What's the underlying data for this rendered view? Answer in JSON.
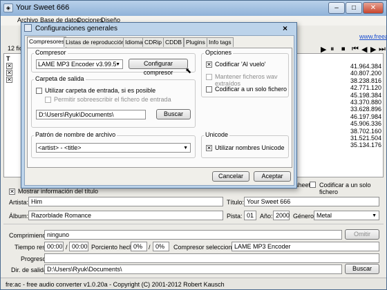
{
  "app": {
    "title": "Your Sweet 666",
    "icon_glyph": "◈",
    "menu": [
      "Archivo",
      "Base de datos",
      "Opciones",
      "Diseño"
    ],
    "link": "www.freeac.org",
    "filecount_prefix": "12 fic",
    "col_letter": "T",
    "sizes": [
      "41.964.384",
      "40.807.200",
      "38.238.816",
      "42.771.120",
      "45.198.384",
      "43.370.880",
      "33.628.896",
      "46.197.984",
      "45.906.336",
      "38.702.160",
      "31.521.504",
      "35.134.176"
    ],
    "player_controls": [
      "▶",
      "⏸",
      "⏹",
      "⏮",
      "◀",
      "▶",
      "⏭"
    ],
    "behind_options": {
      "sheet": "sheet",
      "single_file": "Codificar a un solo fichero"
    },
    "show_title_info": "Mostrar información del título",
    "artist_label": "Artista:",
    "artist": "Him",
    "title_label": "Título:",
    "album_label": "Álbum:",
    "album": "Razorblade Romance",
    "track_label": "Pista:",
    "track": "01",
    "year_label": "Año:",
    "year": "2000",
    "genre_label": "Género:",
    "genre": "Metal",
    "compressing_label": "Comprimiendo:",
    "compressing": "ninguno",
    "skip_button": "Omitir",
    "time_label": "Tiempo res.:",
    "time1": "00:00",
    "time_sep": "/",
    "time2": "00:00",
    "percent_label": "Porciento hecho:",
    "pct1": "0%",
    "pct2": "0%",
    "encoder_label": "Compresor seleccionado:",
    "encoder": "LAME MP3 Encoder",
    "progress_label": "Progreso:",
    "outdir_label": "Dir. de salida:",
    "outdir": "D:\\Users\\Ryuk\\Documents\\",
    "browse_button": "Buscar",
    "status": "fre:ac - free audio converter v1.0.20a - Copyright (C) 2001-2012 Robert Kausch"
  },
  "dialog": {
    "title": "Configuraciones generales",
    "close": "×",
    "tabs": [
      "Compresores",
      "Listas de reproducción",
      "Idioma",
      "CDRip",
      "CDDB",
      "Plugins",
      "Info tags"
    ],
    "encoder_group": "Compresor",
    "encoder_value": "LAME MP3 Encoder v3.99.5",
    "configure_button": "Configurar compresor",
    "output_group": "Carpeta de salida",
    "use_input_folder": "Utilizar carpeta de entrada, si es posible",
    "allow_overwrite": "Permitir sobreescribir el fichero de entrada",
    "output_path": "D:\\Users\\Ryuk\\Documents\\",
    "browse_button": "Buscar",
    "pattern_group": "Patrón de nombre de archivo",
    "pattern_value": "<artist> - <title>",
    "options_group": "Opciones",
    "on_the_fly": "Codificar 'Al vuelo'",
    "keep_wav": "Mantener ficheros wav extraídos",
    "single_file": "Codificar a un solo fichero",
    "unicode_group": "Unicode",
    "use_unicode": "Utilizar nombres Unicode",
    "check_mark": "✕",
    "cancel_button": "Cancelar",
    "ok_button": "Aceptar"
  }
}
